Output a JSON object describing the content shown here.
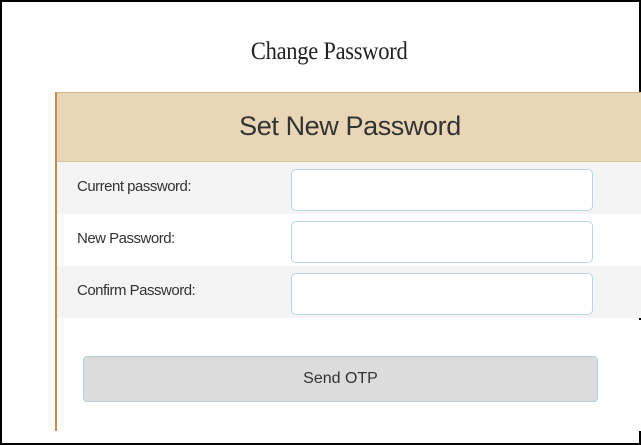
{
  "page": {
    "title": "Change Password"
  },
  "panel": {
    "heading": "Set New Password",
    "fields": [
      {
        "label": "Current password:",
        "value": "",
        "placeholder": ""
      },
      {
        "label": "New Password:",
        "value": "",
        "placeholder": ""
      },
      {
        "label": "Confirm Password:",
        "value": "",
        "placeholder": ""
      }
    ],
    "submit_label": "Send OTP"
  },
  "colors": {
    "header_bg": "#e8d6b6",
    "accent_border": "#c98a4b",
    "button_bg": "#dcdcdc",
    "input_border": "#b9d6e4"
  }
}
